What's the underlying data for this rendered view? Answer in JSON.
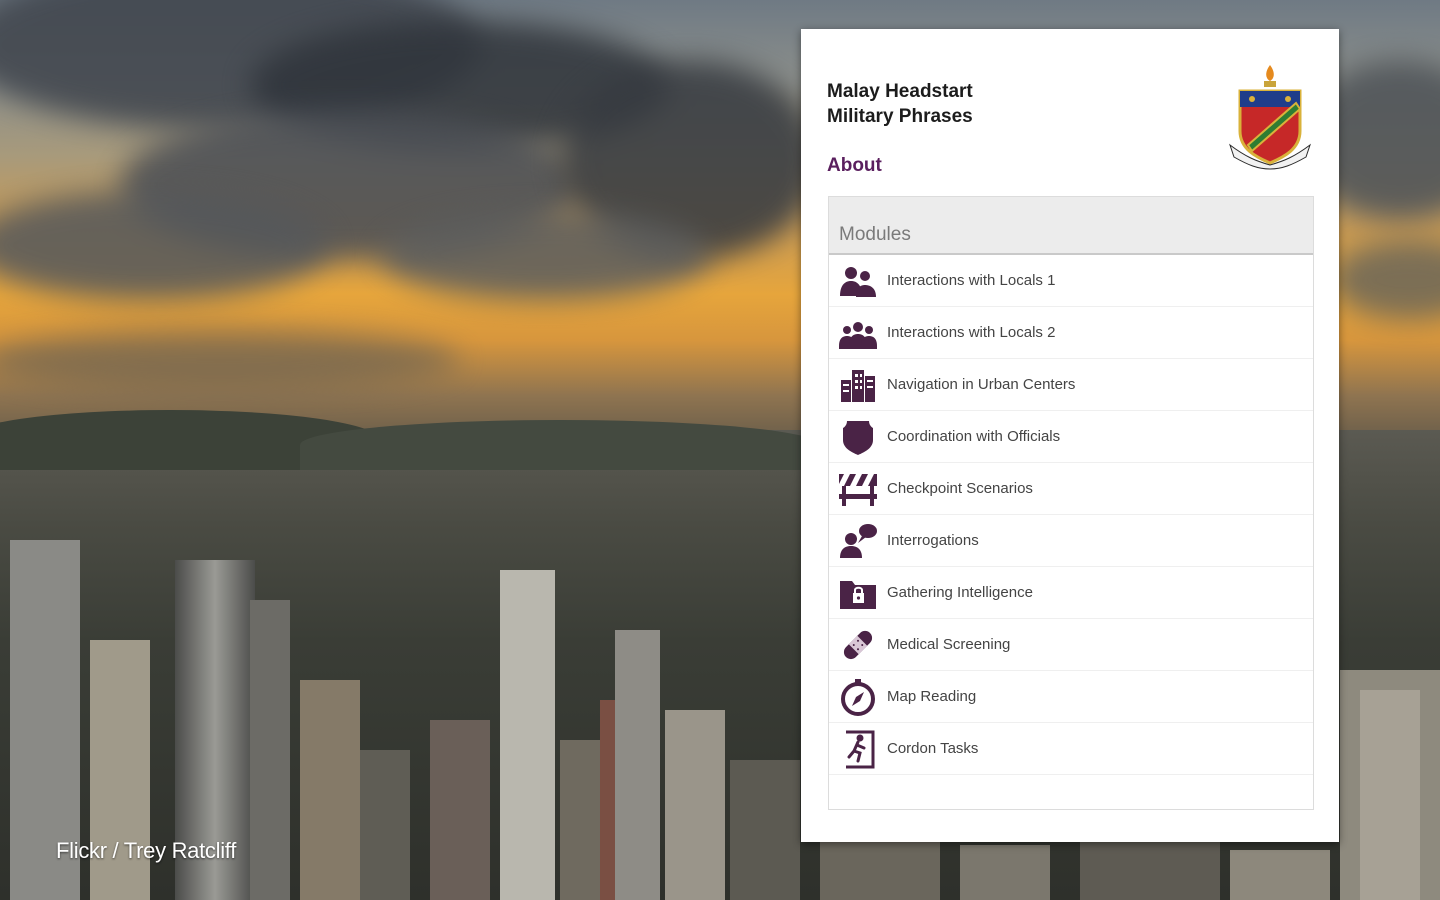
{
  "app": {
    "title_line1": "Malay Headstart",
    "title_line2": "Military Phrases",
    "about_label": "About",
    "accent_color": "#5a1f5e"
  },
  "modules": {
    "header": "Modules",
    "items": [
      {
        "label": "Interactions with Locals 1",
        "icon": "two-people-icon"
      },
      {
        "label": "Interactions with Locals 2",
        "icon": "group-people-icon"
      },
      {
        "label": "Navigation in Urban Centers",
        "icon": "buildings-icon"
      },
      {
        "label": "Coordination with Officials",
        "icon": "badge-shield-icon"
      },
      {
        "label": "Checkpoint Scenarios",
        "icon": "barrier-icon"
      },
      {
        "label": "Interrogations",
        "icon": "speech-person-icon"
      },
      {
        "label": "Gathering Intelligence",
        "icon": "folder-lock-icon"
      },
      {
        "label": "Medical Screening",
        "icon": "bandage-icon"
      },
      {
        "label": "Map Reading",
        "icon": "compass-icon"
      },
      {
        "label": "Cordon Tasks",
        "icon": "exit-runner-icon"
      }
    ]
  },
  "photo_credit": "Flickr / Trey Ratcliff"
}
